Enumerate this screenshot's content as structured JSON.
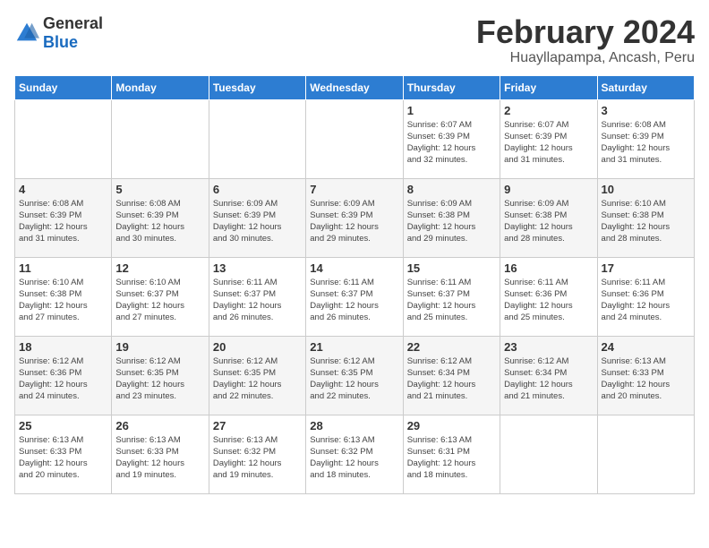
{
  "logo": {
    "general": "General",
    "blue": "Blue"
  },
  "header": {
    "title": "February 2024",
    "subtitle": "Huayllapampa, Ancash, Peru"
  },
  "days_of_week": [
    "Sunday",
    "Monday",
    "Tuesday",
    "Wednesday",
    "Thursday",
    "Friday",
    "Saturday"
  ],
  "weeks": [
    [
      {
        "day": "",
        "info": ""
      },
      {
        "day": "",
        "info": ""
      },
      {
        "day": "",
        "info": ""
      },
      {
        "day": "",
        "info": ""
      },
      {
        "day": "1",
        "info": "Sunrise: 6:07 AM\nSunset: 6:39 PM\nDaylight: 12 hours\nand 32 minutes."
      },
      {
        "day": "2",
        "info": "Sunrise: 6:07 AM\nSunset: 6:39 PM\nDaylight: 12 hours\nand 31 minutes."
      },
      {
        "day": "3",
        "info": "Sunrise: 6:08 AM\nSunset: 6:39 PM\nDaylight: 12 hours\nand 31 minutes."
      }
    ],
    [
      {
        "day": "4",
        "info": "Sunrise: 6:08 AM\nSunset: 6:39 PM\nDaylight: 12 hours\nand 31 minutes."
      },
      {
        "day": "5",
        "info": "Sunrise: 6:08 AM\nSunset: 6:39 PM\nDaylight: 12 hours\nand 30 minutes."
      },
      {
        "day": "6",
        "info": "Sunrise: 6:09 AM\nSunset: 6:39 PM\nDaylight: 12 hours\nand 30 minutes."
      },
      {
        "day": "7",
        "info": "Sunrise: 6:09 AM\nSunset: 6:39 PM\nDaylight: 12 hours\nand 29 minutes."
      },
      {
        "day": "8",
        "info": "Sunrise: 6:09 AM\nSunset: 6:38 PM\nDaylight: 12 hours\nand 29 minutes."
      },
      {
        "day": "9",
        "info": "Sunrise: 6:09 AM\nSunset: 6:38 PM\nDaylight: 12 hours\nand 28 minutes."
      },
      {
        "day": "10",
        "info": "Sunrise: 6:10 AM\nSunset: 6:38 PM\nDaylight: 12 hours\nand 28 minutes."
      }
    ],
    [
      {
        "day": "11",
        "info": "Sunrise: 6:10 AM\nSunset: 6:38 PM\nDaylight: 12 hours\nand 27 minutes."
      },
      {
        "day": "12",
        "info": "Sunrise: 6:10 AM\nSunset: 6:37 PM\nDaylight: 12 hours\nand 27 minutes."
      },
      {
        "day": "13",
        "info": "Sunrise: 6:11 AM\nSunset: 6:37 PM\nDaylight: 12 hours\nand 26 minutes."
      },
      {
        "day": "14",
        "info": "Sunrise: 6:11 AM\nSunset: 6:37 PM\nDaylight: 12 hours\nand 26 minutes."
      },
      {
        "day": "15",
        "info": "Sunrise: 6:11 AM\nSunset: 6:37 PM\nDaylight: 12 hours\nand 25 minutes."
      },
      {
        "day": "16",
        "info": "Sunrise: 6:11 AM\nSunset: 6:36 PM\nDaylight: 12 hours\nand 25 minutes."
      },
      {
        "day": "17",
        "info": "Sunrise: 6:11 AM\nSunset: 6:36 PM\nDaylight: 12 hours\nand 24 minutes."
      }
    ],
    [
      {
        "day": "18",
        "info": "Sunrise: 6:12 AM\nSunset: 6:36 PM\nDaylight: 12 hours\nand 24 minutes."
      },
      {
        "day": "19",
        "info": "Sunrise: 6:12 AM\nSunset: 6:35 PM\nDaylight: 12 hours\nand 23 minutes."
      },
      {
        "day": "20",
        "info": "Sunrise: 6:12 AM\nSunset: 6:35 PM\nDaylight: 12 hours\nand 22 minutes."
      },
      {
        "day": "21",
        "info": "Sunrise: 6:12 AM\nSunset: 6:35 PM\nDaylight: 12 hours\nand 22 minutes."
      },
      {
        "day": "22",
        "info": "Sunrise: 6:12 AM\nSunset: 6:34 PM\nDaylight: 12 hours\nand 21 minutes."
      },
      {
        "day": "23",
        "info": "Sunrise: 6:12 AM\nSunset: 6:34 PM\nDaylight: 12 hours\nand 21 minutes."
      },
      {
        "day": "24",
        "info": "Sunrise: 6:13 AM\nSunset: 6:33 PM\nDaylight: 12 hours\nand 20 minutes."
      }
    ],
    [
      {
        "day": "25",
        "info": "Sunrise: 6:13 AM\nSunset: 6:33 PM\nDaylight: 12 hours\nand 20 minutes."
      },
      {
        "day": "26",
        "info": "Sunrise: 6:13 AM\nSunset: 6:33 PM\nDaylight: 12 hours\nand 19 minutes."
      },
      {
        "day": "27",
        "info": "Sunrise: 6:13 AM\nSunset: 6:32 PM\nDaylight: 12 hours\nand 19 minutes."
      },
      {
        "day": "28",
        "info": "Sunrise: 6:13 AM\nSunset: 6:32 PM\nDaylight: 12 hours\nand 18 minutes."
      },
      {
        "day": "29",
        "info": "Sunrise: 6:13 AM\nSunset: 6:31 PM\nDaylight: 12 hours\nand 18 minutes."
      },
      {
        "day": "",
        "info": ""
      },
      {
        "day": "",
        "info": ""
      }
    ]
  ]
}
